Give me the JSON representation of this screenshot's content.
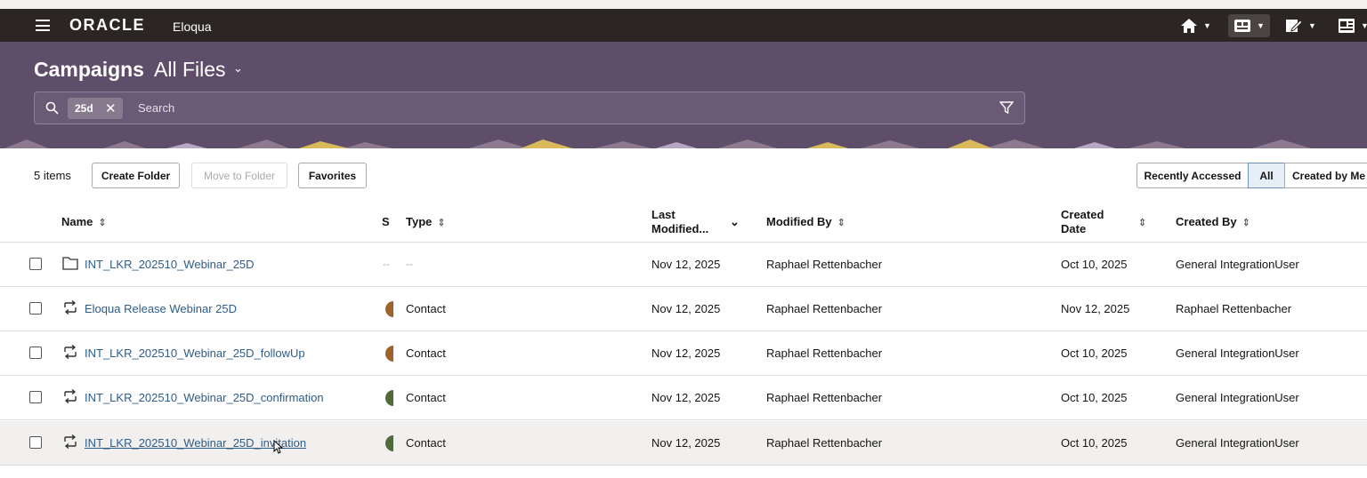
{
  "app": {
    "logo": "ORACLE",
    "product": "Eloqua"
  },
  "navbar": {
    "icons": [
      "home-icon",
      "dashboard-icon",
      "edit-icon",
      "settings-panel-icon"
    ]
  },
  "header": {
    "title": "Campaigns",
    "view": "All Files"
  },
  "search": {
    "chip": "25d",
    "placeholder": "Search"
  },
  "toolbar": {
    "count": "5 items",
    "create_folder": "Create Folder",
    "move_to_folder": "Move to Folder",
    "favorites": "Favorites",
    "filters": [
      "Recently Accessed",
      "All",
      "Created by Me"
    ],
    "selected_filter": "All"
  },
  "columns": {
    "name": "Name",
    "status": "S",
    "type": "Type",
    "last_modified": "Last Modified...",
    "modified_by": "Modified By",
    "created_date": "Created Date",
    "created_by": "Created By"
  },
  "rows": [
    {
      "kind": "folder",
      "name": "INT_LKR_202510_Webinar_25D",
      "status": "--",
      "type": "--",
      "last_modified": "Nov 12, 2025",
      "modified_by": "Raphael Rettenbacher",
      "created_date": "Oct 10, 2025",
      "created_by": "General IntegrationUser",
      "status_color": ""
    },
    {
      "kind": "campaign",
      "name": "Eloqua Release Webinar 25D",
      "status": "",
      "type": "Contact",
      "last_modified": "Nov 12, 2025",
      "modified_by": "Raphael Rettenbacher",
      "created_date": "Nov 12, 2025",
      "created_by": "Raphael Rettenbacher",
      "status_color": "#a0622b"
    },
    {
      "kind": "campaign",
      "name": "INT_LKR_202510_Webinar_25D_followUp",
      "status": "",
      "type": "Contact",
      "last_modified": "Nov 12, 2025",
      "modified_by": "Raphael Rettenbacher",
      "created_date": "Oct 10, 2025",
      "created_by": "General IntegrationUser",
      "status_color": "#a0622b"
    },
    {
      "kind": "campaign",
      "name": "INT_LKR_202510_Webinar_25D_confirmation",
      "status": "",
      "type": "Contact",
      "last_modified": "Nov 12, 2025",
      "modified_by": "Raphael Rettenbacher",
      "created_date": "Oct 10, 2025",
      "created_by": "General IntegrationUser",
      "status_color": "#4f6b3a"
    },
    {
      "kind": "campaign",
      "name": "INT_LKR_202510_Webinar_25D_invitation",
      "status": "",
      "type": "Contact",
      "last_modified": "Nov 12, 2025",
      "modified_by": "Raphael Rettenbacher",
      "created_date": "Oct 10, 2025",
      "created_by": "General IntegrationUser",
      "status_color": "#4f6b3a"
    }
  ],
  "colors": {
    "navbar": "#2b2623",
    "banner": "#5e4e6a",
    "link": "#2e5c8a"
  }
}
